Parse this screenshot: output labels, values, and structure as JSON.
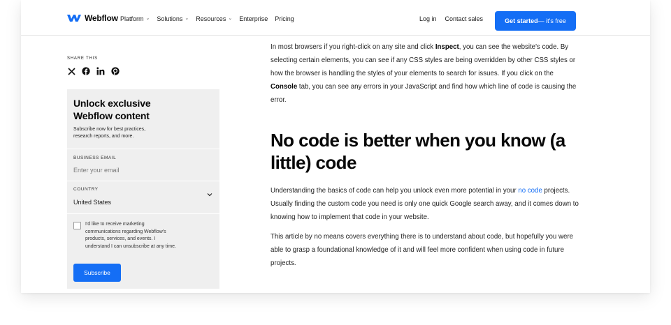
{
  "nav": {
    "brand": "Webflow",
    "links": [
      {
        "label": "Platform",
        "chevron": true
      },
      {
        "label": "Solutions",
        "chevron": true
      },
      {
        "label": "Resources",
        "chevron": true
      },
      {
        "label": "Enterprise",
        "chevron": false
      },
      {
        "label": "Pricing",
        "chevron": false
      }
    ],
    "login": "Log in",
    "contact": "Contact sales",
    "cta_bold": "Get started",
    "cta_rest": " — it's free"
  },
  "share": {
    "label": "SHARE THIS",
    "icons": [
      "x-icon",
      "facebook-icon",
      "linkedin-icon",
      "pinterest-icon"
    ]
  },
  "newsletter": {
    "title": "Unlock exclusive\nWebflow content",
    "subtitle": "Subscribe now for best practices,\nresearch reports, and more.",
    "email_label": "BUSINESS EMAIL",
    "email_placeholder": "Enter your email",
    "email_value": "",
    "country_label": "COUNTRY",
    "country_value": "United States",
    "consent": "I'd like to receive marketing\ncommunications regarding Webflow's\nproducts, services, and events. I\nunderstand I can unsubscribe at any time.",
    "consent_checked": false,
    "subscribe": "Subscribe"
  },
  "article": {
    "p1": {
      "a": "In most browsers if you right-click on any site and click ",
      "b": "Inspect",
      "c": ", you can see the website's code. By selecting certain elements, you can see if any CSS styles are being overridden by other CSS styles or how the browser is handling the styles of your elements to search for issues. If you click on the ",
      "d": "Console",
      "e": " tab, you can see any errors in your JavaScript and find how which line of code is causing the error."
    },
    "heading": "No code is better when you know (a\nlittle) code",
    "p2": {
      "a": "Understanding the basics of code can help you unlock even more potential in your ",
      "link": "no code",
      "b": " projects. Usually finding the custom code you need is only one quick Google search away, and it comes down to knowing how to implement that code in your website."
    },
    "p3": "This article by no means covers everything there is to understand about code, but hopefully you were able to grasp a foundational knowledge of it and will feel more confident when using code in future projects."
  },
  "colors": {
    "accent": "#146ef5",
    "panel": "#efefef",
    "text": "#080808"
  }
}
